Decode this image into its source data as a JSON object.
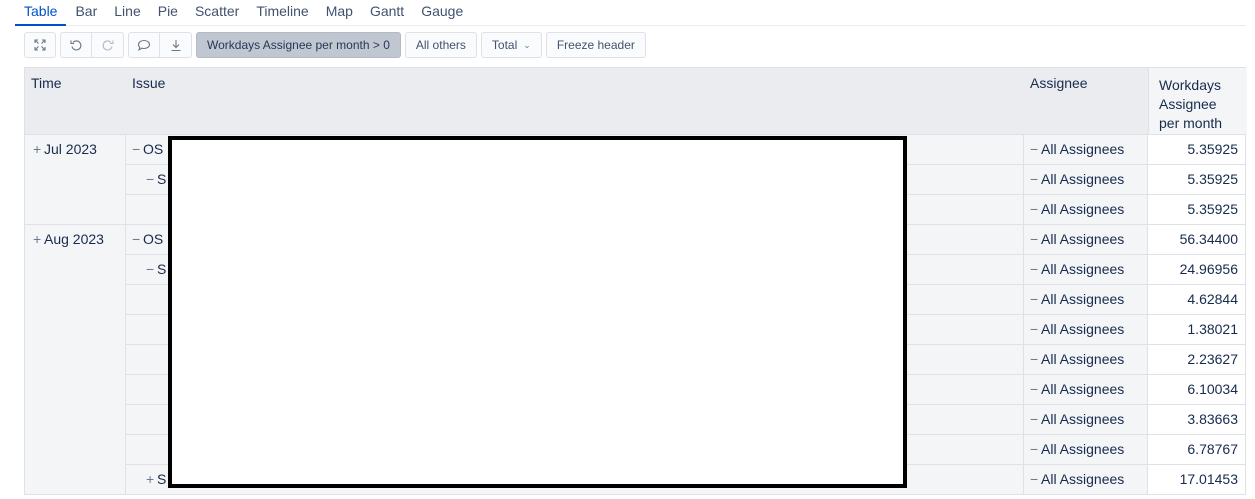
{
  "view_tabs": [
    "Table",
    "Bar",
    "Line",
    "Pie",
    "Scatter",
    "Timeline",
    "Map",
    "Gantt",
    "Gauge"
  ],
  "active_tab": "Table",
  "toolbar": {
    "expand_icon": "fullscreen-icon",
    "undo_icon": "undo-icon",
    "redo_icon": "redo-icon",
    "comment_icon": "comment-icon",
    "download_icon": "download-icon",
    "filter_label": "Workdays Assignee per month > 0",
    "all_others_label": "All others",
    "total_label": "Total",
    "freeze_label": "Freeze header"
  },
  "table": {
    "headers": {
      "time": "Time",
      "issue": "Issue",
      "assignee": "Assignee",
      "value": "Workdays Assignee per month"
    },
    "groups": [
      {
        "time": "Jul 2023",
        "rows": [
          {
            "issue_prefix": "OS",
            "issue_level": 0,
            "issue_sign": "−",
            "assignee": "All Assignees",
            "value": "5.35925"
          },
          {
            "issue_prefix": "S",
            "issue_level": 1,
            "issue_sign": "−",
            "assignee": "All Assignees",
            "value": "5.35925"
          },
          {
            "issue_prefix": "",
            "issue_level": 2,
            "issue_sign": "",
            "assignee": "All Assignees",
            "value": "5.35925"
          }
        ]
      },
      {
        "time": "Aug 2023",
        "rows": [
          {
            "issue_prefix": "OS",
            "issue_level": 0,
            "issue_sign": "−",
            "assignee": "All Assignees",
            "value": "56.34400"
          },
          {
            "issue_prefix": "S",
            "issue_level": 1,
            "issue_sign": "−",
            "assignee": "All Assignees",
            "value": "24.96956"
          },
          {
            "issue_prefix": "",
            "issue_level": 2,
            "issue_sign": "",
            "assignee": "All Assignees",
            "value": "4.62844"
          },
          {
            "issue_prefix": "",
            "issue_level": 2,
            "issue_sign": "",
            "assignee": "All Assignees",
            "value": "1.38021"
          },
          {
            "issue_prefix": "",
            "issue_level": 2,
            "issue_sign": "",
            "assignee": "All Assignees",
            "value": "2.23627"
          },
          {
            "issue_prefix": "",
            "issue_level": 2,
            "issue_sign": "",
            "assignee": "All Assignees",
            "value": "6.10034"
          },
          {
            "issue_prefix": "",
            "issue_level": 2,
            "issue_sign": "",
            "assignee": "All Assignees",
            "value": "3.83663"
          },
          {
            "issue_prefix": "",
            "issue_level": 2,
            "issue_sign": "",
            "assignee": "All Assignees",
            "value": "6.78767"
          },
          {
            "issue_prefix": "S",
            "issue_level": 1,
            "issue_sign": "+",
            "assignee": "All Assignees",
            "value": "17.01453"
          }
        ]
      }
    ]
  },
  "colors": {
    "accent": "#0052cc",
    "header_bg": "#ebecf0",
    "filter_bg": "#c1c7d0",
    "redaction_border": "#000000"
  }
}
